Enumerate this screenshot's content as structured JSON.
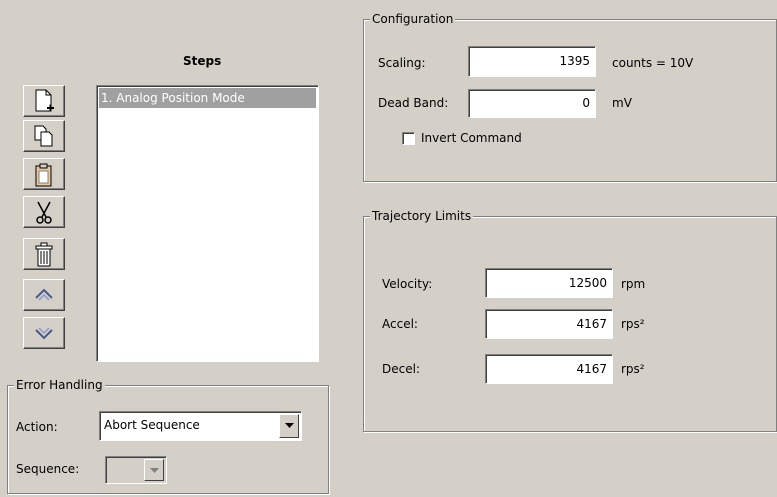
{
  "steps": {
    "title": "Steps",
    "toolbar": [
      {
        "name": "new-step-icon"
      },
      {
        "name": "copy-icon"
      },
      {
        "name": "paste-icon"
      },
      {
        "name": "cut-icon"
      },
      {
        "name": "delete-icon"
      },
      {
        "name": "move-up-icon"
      },
      {
        "name": "move-down-icon"
      }
    ],
    "items": [
      {
        "label": "1. Analog Position Mode",
        "selected": true
      }
    ]
  },
  "error_handling": {
    "title": "Error Handling",
    "action_label": "Action:",
    "action_value": "Abort Sequence",
    "sequence_label": "Sequence:",
    "sequence_value": ""
  },
  "configuration": {
    "title": "Configuration",
    "scaling_label": "Scaling:",
    "scaling_value": "1395",
    "scaling_unit": "counts = 10V",
    "deadband_label": "Dead Band:",
    "deadband_value": "0",
    "deadband_unit": "mV",
    "invert_label": "Invert Command",
    "invert_checked": false
  },
  "trajectory": {
    "title": "Trajectory Limits",
    "velocity_label": "Velocity:",
    "velocity_value": "12500",
    "velocity_unit": "rpm",
    "accel_label": "Accel:",
    "accel_value": "4167",
    "accel_unit": "rps²",
    "decel_label": "Decel:",
    "decel_value": "4167",
    "decel_unit": "rps²"
  },
  "colors": {
    "background": "#d4d0c8",
    "selection": "#a0a0a0"
  }
}
